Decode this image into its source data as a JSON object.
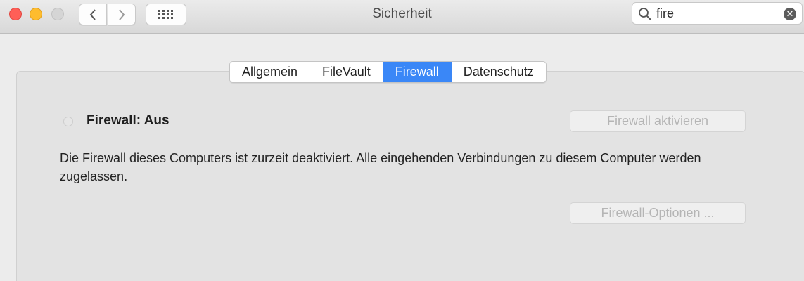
{
  "window": {
    "title": "Sicherheit",
    "traffic_lights": {
      "close_color": "#ff5f57",
      "minimize_color": "#febc2e",
      "zoom_color": "#d5d5d5"
    }
  },
  "toolbar": {
    "back_icon": "chevron-left-icon",
    "forward_icon": "chevron-right-icon",
    "grid_icon": "grid-icon"
  },
  "search": {
    "value": "fire",
    "icon": "search-icon",
    "clear_icon": "clear-icon",
    "clear_glyph": "✕"
  },
  "tabs": [
    {
      "label": "Allgemein",
      "active": false
    },
    {
      "label": "FileVault",
      "active": false
    },
    {
      "label": "Firewall",
      "active": true
    },
    {
      "label": "Datenschutz",
      "active": false
    }
  ],
  "firewall": {
    "status_label": "Firewall: Aus",
    "activate_button": "Firewall aktivieren",
    "description": "Die Firewall dieses Computers ist zurzeit deaktiviert. Alle eingehenden Verbindungen zu diesem Computer werden zugelassen.",
    "options_button": "Firewall-Optionen ..."
  },
  "colors": {
    "accent": "#3a87f7"
  }
}
